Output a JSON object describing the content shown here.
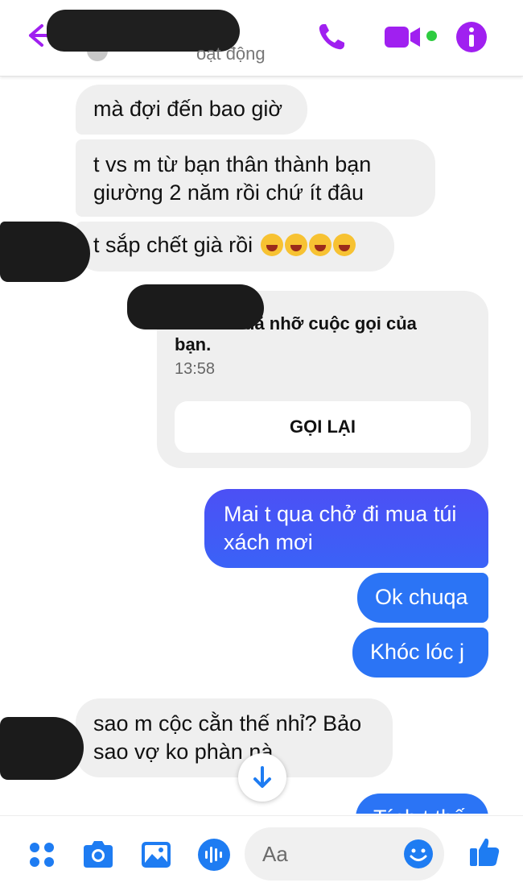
{
  "header": {
    "status": "oạt động",
    "icons": [
      "back-arrow-icon",
      "phone-icon",
      "video-camera-icon",
      "info-icon"
    ],
    "accent_color": "#a020f0"
  },
  "messages": [
    {
      "side": "in",
      "text": "mà đợi đến bao giờ"
    },
    {
      "side": "in",
      "text": "t vs m từ bạn thân thành bạn giường 2 năm rồi chứ ít đâu"
    },
    {
      "side": "in",
      "text": "t sắp chết già rồi",
      "emoji": [
        "crying-face-icon",
        "crying-face-icon",
        "crying-face-icon",
        "crying-face-icon"
      ]
    },
    {
      "side": "out",
      "text": "Mai t qua chở đi mua túi xách mơi"
    },
    {
      "side": "out",
      "text": "Ok chuqa"
    },
    {
      "side": "out",
      "text": "Khóc lóc j"
    },
    {
      "side": "in",
      "text": "sao m cộc cằn thế nhỉ? Bảo sao vợ ko phàn nà"
    },
    {
      "side": "out",
      "text": "Tính t thế"
    }
  ],
  "call_card": {
    "title": "đã nhỡ cuộc gọi của",
    "title_cont": "bạn.",
    "time": "13:58",
    "button": "GỌI LẠI"
  },
  "composer": {
    "placeholder": "Aa",
    "icons": [
      "apps-grid-icon",
      "camera-icon",
      "image-icon",
      "microphone-icon",
      "emoji-icon",
      "thumbs-up-icon"
    ]
  },
  "colors": {
    "outgoing_top": "#4c50f5",
    "outgoing_bottom": "#2b74f5",
    "incoming": "#efefef",
    "icon_blue": "#1e7cf2"
  }
}
